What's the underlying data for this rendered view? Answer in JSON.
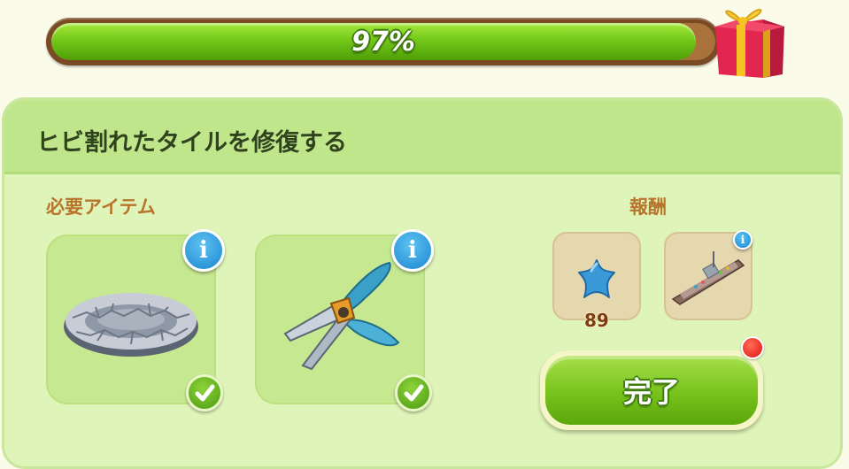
{
  "progress": {
    "value": 0.97,
    "label": "97%"
  },
  "task": {
    "title": "ヒビ割れたタイルを修復する",
    "required_label": "必要アイテム",
    "reward_label": "報酬",
    "required_items": [
      {
        "icon": "cracked-stone-tile-icon",
        "info": "i",
        "completed": true
      },
      {
        "icon": "pruning-shears-icon",
        "info": "i",
        "completed": true
      }
    ],
    "rewards": [
      {
        "icon": "blue-star-icon",
        "count": "89"
      },
      {
        "icon": "ship-icon",
        "info": "i"
      }
    ],
    "complete_button": "完了"
  },
  "colors": {
    "progress_fill": "#74c81a",
    "panel_bg": "#dff4b9",
    "header_bg": "#bfe68b",
    "section_label": "#b8742b",
    "info_blue": "#1a86cf",
    "notify_red": "#e0150c"
  }
}
